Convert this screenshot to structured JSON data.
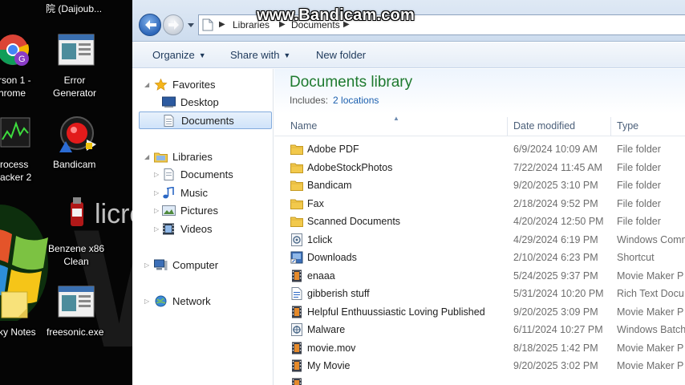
{
  "watermark": "www.Bandicam.com",
  "desktop": {
    "top_fragment": "院 (Daijoub...",
    "icons": [
      {
        "name": "chrome-person",
        "label_lines": [
          "rson 1 -",
          "hrome"
        ]
      },
      {
        "name": "error-generator",
        "label_lines": [
          "Error",
          "Generator"
        ]
      },
      {
        "name": "process-hacker",
        "label_lines": [
          "rocess",
          "acker 2"
        ]
      },
      {
        "name": "bandicam",
        "label_lines": [
          "Bandicam"
        ]
      },
      {
        "name": "benzene",
        "label_lines": [
          "Benzene x86",
          "Clean"
        ]
      },
      {
        "name": "sticky-notes",
        "label_lines": [
          "ky Notes"
        ]
      },
      {
        "name": "freesonic",
        "label_lines": [
          "freesonic.exe"
        ]
      }
    ],
    "bg_text": "licro"
  },
  "address": {
    "crumbs": [
      "Libraries",
      "Documents"
    ]
  },
  "toolbar": {
    "organize": "Organize",
    "share_with": "Share with",
    "new_folder": "New folder"
  },
  "nav": {
    "favorites": "Favorites",
    "desktop": "Desktop",
    "documents": "Documents",
    "libraries": "Libraries",
    "lib_documents": "Documents",
    "music": "Music",
    "pictures": "Pictures",
    "videos": "Videos",
    "computer": "Computer",
    "network": "Network"
  },
  "library": {
    "title": "Documents library",
    "includes_label": "Includes:",
    "locations": "2 locations"
  },
  "columns": {
    "name": "Name",
    "date": "Date modified",
    "type": "Type"
  },
  "files": [
    {
      "name": "Adobe PDF",
      "date": "6/9/2024 10:09 AM",
      "type": "File folder",
      "icon": "folder-icon"
    },
    {
      "name": "AdobeStockPhotos",
      "date": "7/22/2024 11:45 AM",
      "type": "File folder",
      "icon": "folder-icon"
    },
    {
      "name": "Bandicam",
      "date": "9/20/2025 3:10 PM",
      "type": "File folder",
      "icon": "folder-icon"
    },
    {
      "name": "Fax",
      "date": "2/18/2024 9:52 PM",
      "type": "File folder",
      "icon": "folder-icon"
    },
    {
      "name": "Scanned Documents",
      "date": "4/20/2024 12:50 PM",
      "type": "File folder",
      "icon": "folder-icon"
    },
    {
      "name": "1click",
      "date": "4/29/2024 6:19 PM",
      "type": "Windows Comm",
      "icon": "cmd-file-icon"
    },
    {
      "name": "Downloads",
      "date": "2/10/2024 6:23 PM",
      "type": "Shortcut",
      "icon": "shortcut-icon"
    },
    {
      "name": "enaaa",
      "date": "5/24/2025 9:37 PM",
      "type": "Movie Maker P",
      "icon": "movie-project-icon"
    },
    {
      "name": "gibberish stuff",
      "date": "5/31/2024 10:20 PM",
      "type": "Rich Text Docu",
      "icon": "rtf-icon"
    },
    {
      "name": "Helpful Enthuussiastic Loving Published",
      "date": "9/20/2025 3:09 PM",
      "type": "Movie Maker P",
      "icon": "movie-project-icon"
    },
    {
      "name": "Malware",
      "date": "6/11/2024 10:27 PM",
      "type": "Windows Batch",
      "icon": "batch-icon"
    },
    {
      "name": "movie.mov",
      "date": "8/18/2025 1:42 PM",
      "type": "Movie Maker P",
      "icon": "movie-project-icon"
    },
    {
      "name": "My Movie",
      "date": "9/20/2025 3:02 PM",
      "type": "Movie Maker P",
      "icon": "movie-project-icon"
    },
    {
      "name": "",
      "date": "",
      "type": "",
      "icon": "movie-project-icon"
    }
  ],
  "colors": {
    "accent_green": "#1e7a2e",
    "link_blue": "#1b5fae",
    "selection": "#cfe3fa"
  }
}
